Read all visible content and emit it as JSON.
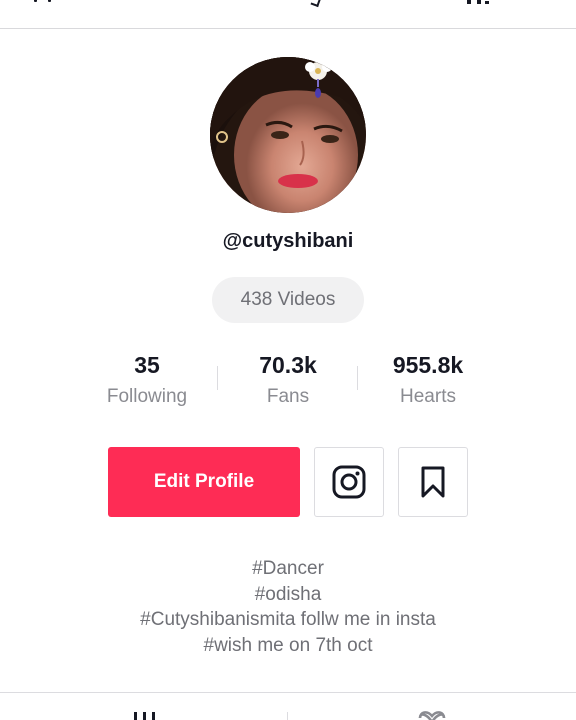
{
  "profile": {
    "username": "@cutyshibani",
    "videos_label": "438 Videos"
  },
  "stats": [
    {
      "value": "35",
      "label": "Following"
    },
    {
      "value": "70.3k",
      "label": "Fans"
    },
    {
      "value": "955.8k",
      "label": "Hearts"
    }
  ],
  "actions": {
    "edit_profile_label": "Edit Profile",
    "instagram_icon": "instagram-icon",
    "bookmark_icon": "bookmark-icon"
  },
  "bio": {
    "lines": [
      "#Dancer",
      "#odisha",
      "#Cutyshibanismita follw me in insta",
      "#wish me on 7th oct"
    ]
  },
  "tabs": [
    {
      "icon": "grid-icon"
    },
    {
      "icon": "heart-icon"
    }
  ],
  "colors": {
    "accent": "#fe2c55",
    "text_primary": "#161823",
    "text_secondary": "#8a8b91"
  }
}
